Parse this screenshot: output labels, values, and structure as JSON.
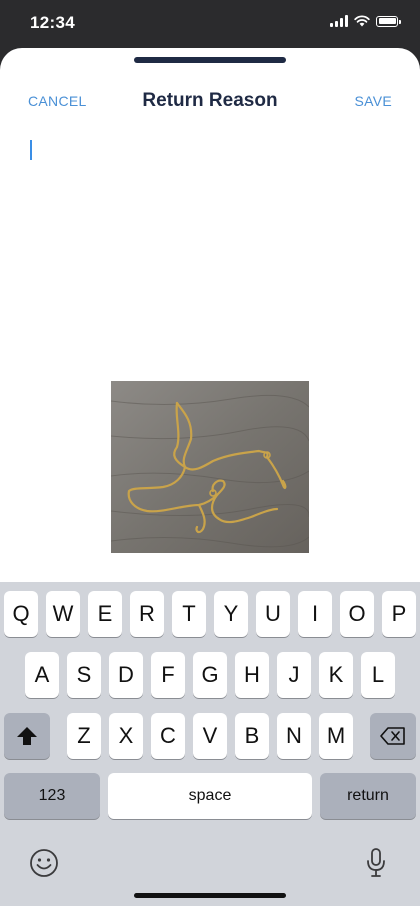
{
  "status_bar": {
    "time": "12:34"
  },
  "sheet": {
    "cancel_label": "CANCEL",
    "title": "Return Reason",
    "save_label": "SAVE",
    "text_value": ""
  },
  "keyboard": {
    "row1": [
      "Q",
      "W",
      "E",
      "R",
      "T",
      "Y",
      "U",
      "I",
      "O",
      "P"
    ],
    "row2": [
      "A",
      "S",
      "D",
      "F",
      "G",
      "H",
      "J",
      "K",
      "L"
    ],
    "row3": [
      "Z",
      "X",
      "C",
      "V",
      "B",
      "N",
      "M"
    ],
    "numbers_label": "123",
    "space_label": "space",
    "return_label": "return"
  },
  "colors": {
    "accent": "#4a90d6",
    "title": "#1f2a44",
    "keyboard_bg": "#d1d4da"
  }
}
